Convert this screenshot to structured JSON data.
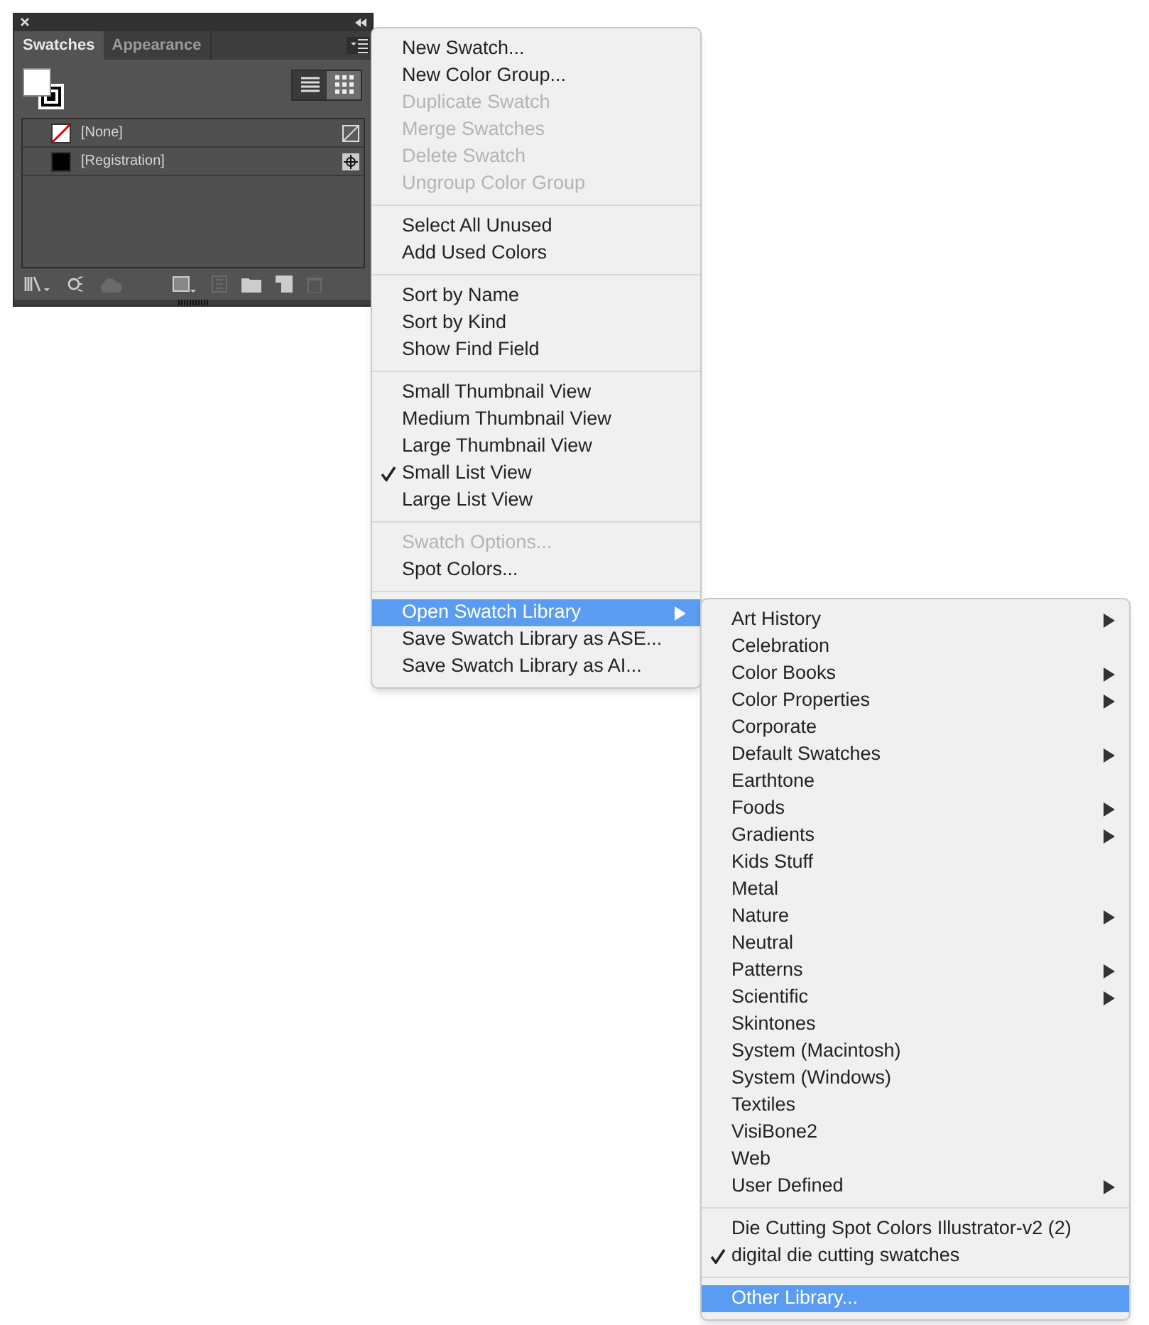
{
  "panel": {
    "tabs": [
      {
        "label": "Swatches",
        "selected": true
      },
      {
        "label": "Appearance",
        "selected": false
      }
    ],
    "views": [
      {
        "kind": "list",
        "selected": false
      },
      {
        "kind": "grid",
        "selected": true
      }
    ],
    "swatches": [
      {
        "name": "[None]",
        "kind": "none"
      },
      {
        "name": "[Registration]",
        "kind": "registration"
      }
    ]
  },
  "menu": {
    "groups": [
      [
        {
          "label": "New Swatch...",
          "disabled": false
        },
        {
          "label": "New Color Group...",
          "disabled": false
        },
        {
          "label": "Duplicate Swatch",
          "disabled": true
        },
        {
          "label": "Merge Swatches",
          "disabled": true
        },
        {
          "label": "Delete Swatch",
          "disabled": true
        },
        {
          "label": "Ungroup Color Group",
          "disabled": true
        }
      ],
      [
        {
          "label": "Select All Unused",
          "disabled": false
        },
        {
          "label": "Add Used Colors",
          "disabled": false
        }
      ],
      [
        {
          "label": "Sort by Name",
          "disabled": false
        },
        {
          "label": "Sort by Kind",
          "disabled": false
        },
        {
          "label": "Show Find Field",
          "disabled": false
        }
      ],
      [
        {
          "label": "Small Thumbnail View",
          "checked": false
        },
        {
          "label": "Medium Thumbnail View",
          "checked": false
        },
        {
          "label": "Large Thumbnail View",
          "checked": false
        },
        {
          "label": "Small List View",
          "checked": true
        },
        {
          "label": "Large List View",
          "checked": false
        }
      ],
      [
        {
          "label": "Swatch Options...",
          "disabled": true
        },
        {
          "label": "Spot Colors...",
          "disabled": false
        }
      ],
      [
        {
          "label": "Open Swatch Library",
          "selected": true,
          "submenu": true
        },
        {
          "label": "Save Swatch Library as ASE...",
          "selected": false
        },
        {
          "label": "Save Swatch Library as AI...",
          "selected": false
        }
      ]
    ]
  },
  "submenu": {
    "groups": [
      [
        {
          "label": "Art History",
          "submenu": true
        },
        {
          "label": "Celebration",
          "submenu": false
        },
        {
          "label": "Color Books",
          "submenu": true
        },
        {
          "label": "Color Properties",
          "submenu": true
        },
        {
          "label": "Corporate",
          "submenu": false
        },
        {
          "label": "Default Swatches",
          "submenu": true
        },
        {
          "label": "Earthtone",
          "submenu": false
        },
        {
          "label": "Foods",
          "submenu": true
        },
        {
          "label": "Gradients",
          "submenu": true
        },
        {
          "label": "Kids Stuff",
          "submenu": false
        },
        {
          "label": "Metal",
          "submenu": false
        },
        {
          "label": "Nature",
          "submenu": true
        },
        {
          "label": "Neutral",
          "submenu": false
        },
        {
          "label": "Patterns",
          "submenu": true
        },
        {
          "label": "Scientific",
          "submenu": true
        },
        {
          "label": "Skintones",
          "submenu": false
        },
        {
          "label": "System (Macintosh)",
          "submenu": false
        },
        {
          "label": "System (Windows)",
          "submenu": false
        },
        {
          "label": "Textiles",
          "submenu": false
        },
        {
          "label": "VisiBone2",
          "submenu": false
        },
        {
          "label": "Web",
          "submenu": false
        },
        {
          "label": "User Defined",
          "submenu": true
        }
      ],
      [
        {
          "label": "Die Cutting Spot Colors Illustrator-v2 (2)",
          "checked": false
        },
        {
          "label": "digital die cutting swatches",
          "checked": true
        }
      ],
      [
        {
          "label": "Other Library...",
          "selected": true
        }
      ]
    ]
  }
}
